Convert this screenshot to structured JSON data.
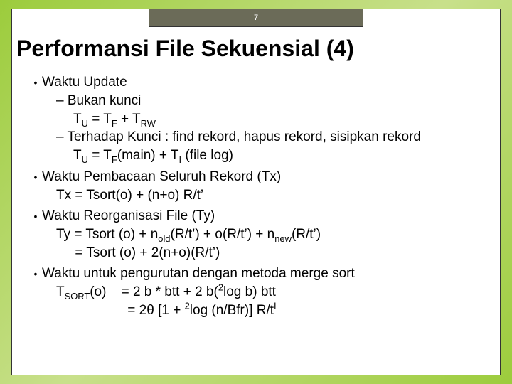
{
  "page_number": "7",
  "title": "Performansi File Sekuensial (4)",
  "bullets": [
    {
      "text": "Waktu Update",
      "subs": [
        {
          "dash": "– Bukan kunci",
          "eq": "T_U = T_F + T_RW"
        },
        {
          "dash": "– Terhadap Kunci : find rekord, hapus rekord, sisipkan rekord",
          "eq": "T_U = T_F(main) + T_I (file log)"
        }
      ]
    },
    {
      "text": "Waktu Pembacaan Seluruh Rekord (Tx)",
      "eqs": [
        "Tx = Tsort(o) + (n+o) R/t’"
      ]
    },
    {
      "text": "Waktu Reorganisasi File (Ty)",
      "eqs": [
        "Ty = Tsort (o) + n_old(R/t’) + o(R/t’) + n_new(R/t’)",
        "     = Tsort (o) + 2(n+o)(R/t’)"
      ]
    },
    {
      "text": "Waktu untuk pengurutan dengan metoda merge sort",
      "eqs": [
        "T_SORT(o)    = 2 b * btt + 2 b(^2log b) btt",
        "                    = 2θ [1 + ^2log (n/Bfr)] R/t^I"
      ]
    }
  ]
}
